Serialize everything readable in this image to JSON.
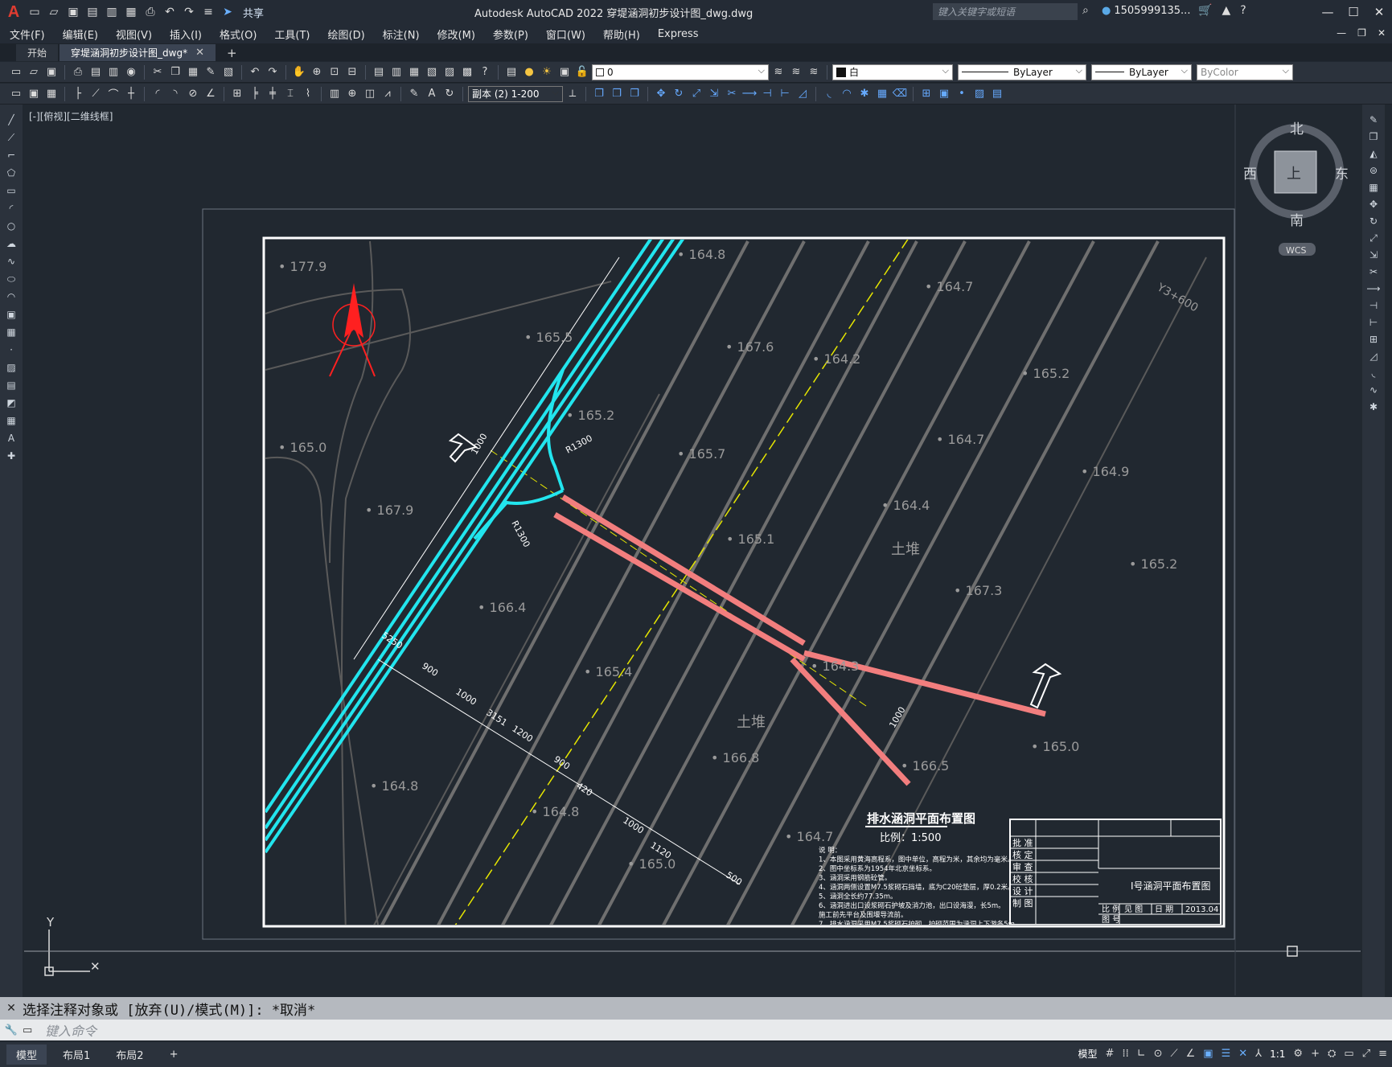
{
  "app": {
    "logo": "A",
    "title": "Autodesk AutoCAD 2022    穿堤涵洞初步设计图_dwg.dwg"
  },
  "qat": {
    "share": "共享"
  },
  "search": {
    "placeholder": "键入关键字或短语"
  },
  "user": {
    "name": "1505999135..."
  },
  "menu": [
    "文件(F)",
    "编辑(E)",
    "视图(V)",
    "插入(I)",
    "格式(O)",
    "工具(T)",
    "绘图(D)",
    "标注(N)",
    "修改(M)",
    "参数(P)",
    "窗口(W)",
    "帮助(H)",
    "Express"
  ],
  "tabs": [
    {
      "label": "开始"
    },
    {
      "label": "穿堤涵洞初步设计图_dwg*"
    }
  ],
  "props": {
    "layer": "0",
    "color": "白",
    "linetype": "ByLayer",
    "lineweight": "ByLayer",
    "plotstyle": "ByColor",
    "annoscale": "副本 (2) 1-200"
  },
  "viewport_label": "[-][俯视][二维线框]",
  "viewcube": {
    "north": "北",
    "south": "南",
    "east": "东",
    "west": "西",
    "top": "上",
    "wcs": "WCS"
  },
  "elevations": [
    "177.9",
    "164.8",
    "165.5",
    "167.6",
    "164.2",
    "164.7",
    "165.2",
    "165.0",
    "165.7",
    "164.7",
    "164.9",
    "167.9",
    "164.4",
    "165.1",
    "165.2",
    "167.3",
    "166.4",
    "164.3",
    "165.4",
    "165.0",
    "166.8",
    "166.5",
    "164.8",
    "164.8",
    "164.7",
    "165.0",
    "165.2"
  ],
  "labels": {
    "soil_pile_1": "土堆",
    "soil_pile_2": "土堆",
    "r1300a": "R1300",
    "r1300b": "R1300",
    "y": "Y3+600",
    "dist_1000a": "1000",
    "dist_1000b": "1000"
  },
  "dims": [
    "900",
    "1000",
    "1200",
    "900",
    "420",
    "1000",
    "1120",
    "500",
    "3151",
    "5250"
  ],
  "plan_title": "排水涵洞平面布置图",
  "plan_scale": "比例：1:500",
  "notes": [
    "说  明：",
    "1、本图采用黄海高程系，图中单位，高程为米，其余均为毫米。",
    "2、图中坐标系为1954年北京坐标系。",
    "3、涵洞采用钢筋砼管。",
    "4、涵洞两侧设置M7.5浆砌石挡墙，底为C20砼垫层，厚0.2米。",
    "5、涵洞全长约77.35m。",
    "6、涵洞进出口设浆砌石护坡及消力池，出口设海漫，长5m。",
    "   施工前先平台及围堰导流前。",
    "7、排水涵洞采用M7.5浆砌石护砌，护砌范围为涵洞上下游各5m。"
  ],
  "title_block": {
    "rows": [
      "批 准",
      "核 定",
      "审 查",
      "校 核",
      "设 计",
      "制 图"
    ],
    "drawing_name": "I号涵洞平面布置图",
    "scale_label": "比 例",
    "scale_val": "见 图",
    "date_label": "日 期",
    "date_val": "2013.04",
    "no_label": "图 号"
  },
  "command": {
    "history": "选择注释对象或 [放弃(U)/模式(M)]: *取消*",
    "placeholder": "键入命令"
  },
  "layouts": [
    "模型",
    "布局1",
    "布局2"
  ],
  "status": {
    "model": "模型",
    "scale": "1:1"
  },
  "colors": {
    "cyan": "#22e5ee",
    "pink": "#f27e7e",
    "red": "#ff2020",
    "yellow": "#e6e600",
    "grey": "#8c8c8c"
  }
}
